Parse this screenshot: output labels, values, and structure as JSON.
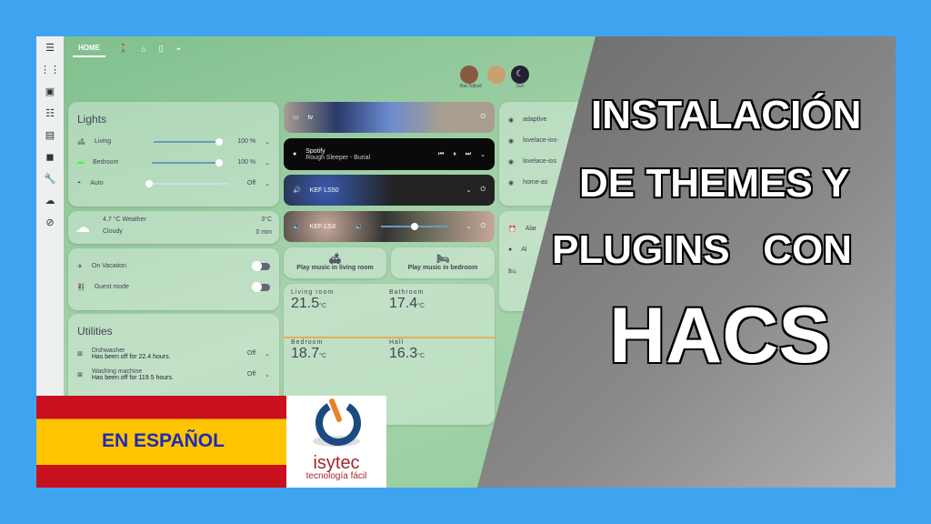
{
  "tabs": {
    "home": "HOME"
  },
  "header": {
    "person1": "Bas Nijholt",
    "person2": "Sun"
  },
  "lights": {
    "title": "Lights",
    "items": [
      {
        "label": "Living",
        "value": "100 %",
        "level": 100
      },
      {
        "label": "Bedroom",
        "value": "100 %",
        "level": 100
      },
      {
        "label": "Auto",
        "value": "Off",
        "level": 0
      }
    ]
  },
  "weather": {
    "title": "4.7 °C Weather",
    "state": "Cloudy",
    "temp": "3°C",
    "precip": "0 mm"
  },
  "modes": [
    {
      "label": "On Vacation"
    },
    {
      "label": "Guest mode"
    }
  ],
  "utilities": {
    "title": "Utilities",
    "items": [
      {
        "name": "Dishwasher",
        "status": "Has been off for 22.4 hours.",
        "state": "Off"
      },
      {
        "name": "Washing machine",
        "status": "Has been off for 119.5 hours.",
        "state": "Off"
      }
    ]
  },
  "media": {
    "tv": "tv",
    "spotify": "Spotify",
    "track": "Rough Sleeper - Burial",
    "kef1": "KEF LS50",
    "kef2": "KEF LSX"
  },
  "buttons": {
    "living": "Play music in living room",
    "bedroom": "Play music in bedroom"
  },
  "temps": [
    {
      "room": "Living room",
      "value": "21.5",
      "unit": "°C"
    },
    {
      "room": "Bathroom",
      "value": "17.4",
      "unit": "°C"
    },
    {
      "room": "Bedroom",
      "value": "18.7",
      "unit": "°C"
    },
    {
      "room": "Hall",
      "value": "16.3",
      "unit": "°C"
    }
  ],
  "repos": [
    "adaptive",
    "lovelace-ios-",
    "lovelace-ios",
    "home-as"
  ],
  "alarms": [
    "Alar",
    "Al"
  ],
  "headline": {
    "l1": "INSTALACIÓN",
    "l2": "DE THEMES Y",
    "l3": "PLUGINS   CON",
    "l4": "HACS"
  },
  "badge": "EN ESPAÑOL",
  "logo": {
    "name": "isytec",
    "tagline": "tecnología fácil"
  }
}
